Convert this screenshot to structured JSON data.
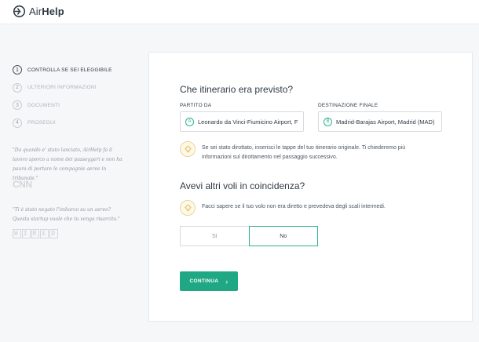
{
  "brand": {
    "name_light": "Air",
    "name_bold": "Help"
  },
  "steps": [
    {
      "num": "1",
      "label": "CONTROLLA SE SEI ELEGGIBILE"
    },
    {
      "num": "2",
      "label": "ULTERIORI INFORMAZIONI"
    },
    {
      "num": "3",
      "label": "DOCUMENTI"
    },
    {
      "num": "4",
      "label": "PROSEGUI"
    }
  ],
  "testimonials": [
    {
      "quote": "\"Da quando e' stato lanciato, AirHelp fa il lavoro sporco a nome dei passeggeri e non ha paura di portare le compagnie aeree in tribunale.\"",
      "source": "CNN"
    },
    {
      "quote": "\"Ti è stato negato l'imbarco su un aereo? Questa startup vuole che tu venga risarcito.\"",
      "source": "WIRED"
    }
  ],
  "form": {
    "itinerary_title": "Che itinerario era previsto?",
    "departure": {
      "label": "PARTITO DA",
      "badge": "A",
      "value": "Leonardo da Vinci-Fiumicino Airport, F"
    },
    "destination": {
      "label": "DESTINAZIONE FINALE",
      "badge": "B",
      "value": "Madrid-Barajas Airport, Madrid (MAD)"
    },
    "diversion_hint": "Se sei stato dirottato, inserisci le tappe del tuo itinerario originale. Ti chiederemo più informazioni sul dirottamento nel passaggio successivo.",
    "connections_title": "Avevi altri voli in coincidenza?",
    "connections_hint": "Facci sapere se il tuo volo non era diretto e prevedeva degli scali intermedi.",
    "option_yes": "Sì",
    "option_no": "No",
    "selected_option": "No",
    "continue_label": "CONTINUA"
  },
  "colors": {
    "accent": "#20a884",
    "hint_bg": "#fff8e6"
  }
}
